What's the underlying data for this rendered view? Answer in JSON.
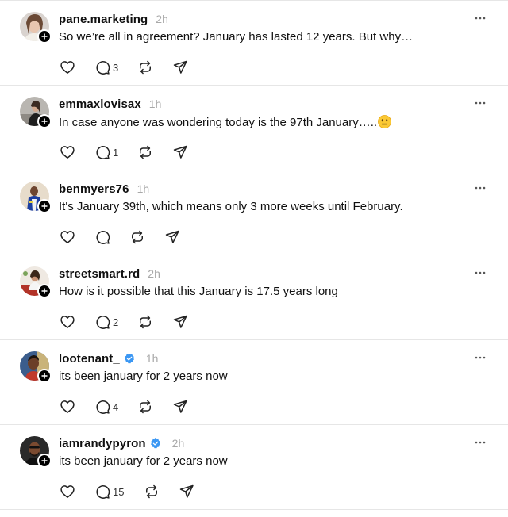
{
  "colors": {
    "verified": "#3b97f3",
    "muted_text": "#a8a8a8",
    "divider": "#e6e6e6",
    "badge": "#000000"
  },
  "icons": {
    "more": "more-horizontal-icon",
    "like": "heart-icon",
    "reply": "comment-bubble-icon",
    "repost": "repost-icon",
    "share": "send-icon",
    "follow": "plus-icon",
    "verified": "verified-badge-icon"
  },
  "posts": [
    {
      "username": "pane.marketing",
      "time": "2h",
      "text": "So we’re all in agreement? January has lasted 12 years. But why…",
      "replies": "3",
      "verified": false,
      "emoji": false
    },
    {
      "username": "emmaxlovisax",
      "time": "1h",
      "text": "In case anyone was wondering today is the 97th January…..",
      "replies": "1",
      "verified": false,
      "emoji": true
    },
    {
      "username": "benmyers76",
      "time": "1h",
      "text": "It's January 39th, which means only 3 more weeks until February.",
      "replies": "",
      "verified": false,
      "emoji": false
    },
    {
      "username": "streetsmart.rd",
      "time": "2h",
      "text": "How is it possible that this January is 17.5 years long",
      "replies": "2",
      "verified": false,
      "emoji": false
    },
    {
      "username": "lootenant_",
      "time": "1h",
      "text": "its been january for 2 years now",
      "replies": "4",
      "verified": true,
      "emoji": false
    },
    {
      "username": "iamrandypyron",
      "time": "2h",
      "text": "its been january for 2 years now",
      "replies": "15",
      "verified": true,
      "emoji": false
    }
  ]
}
